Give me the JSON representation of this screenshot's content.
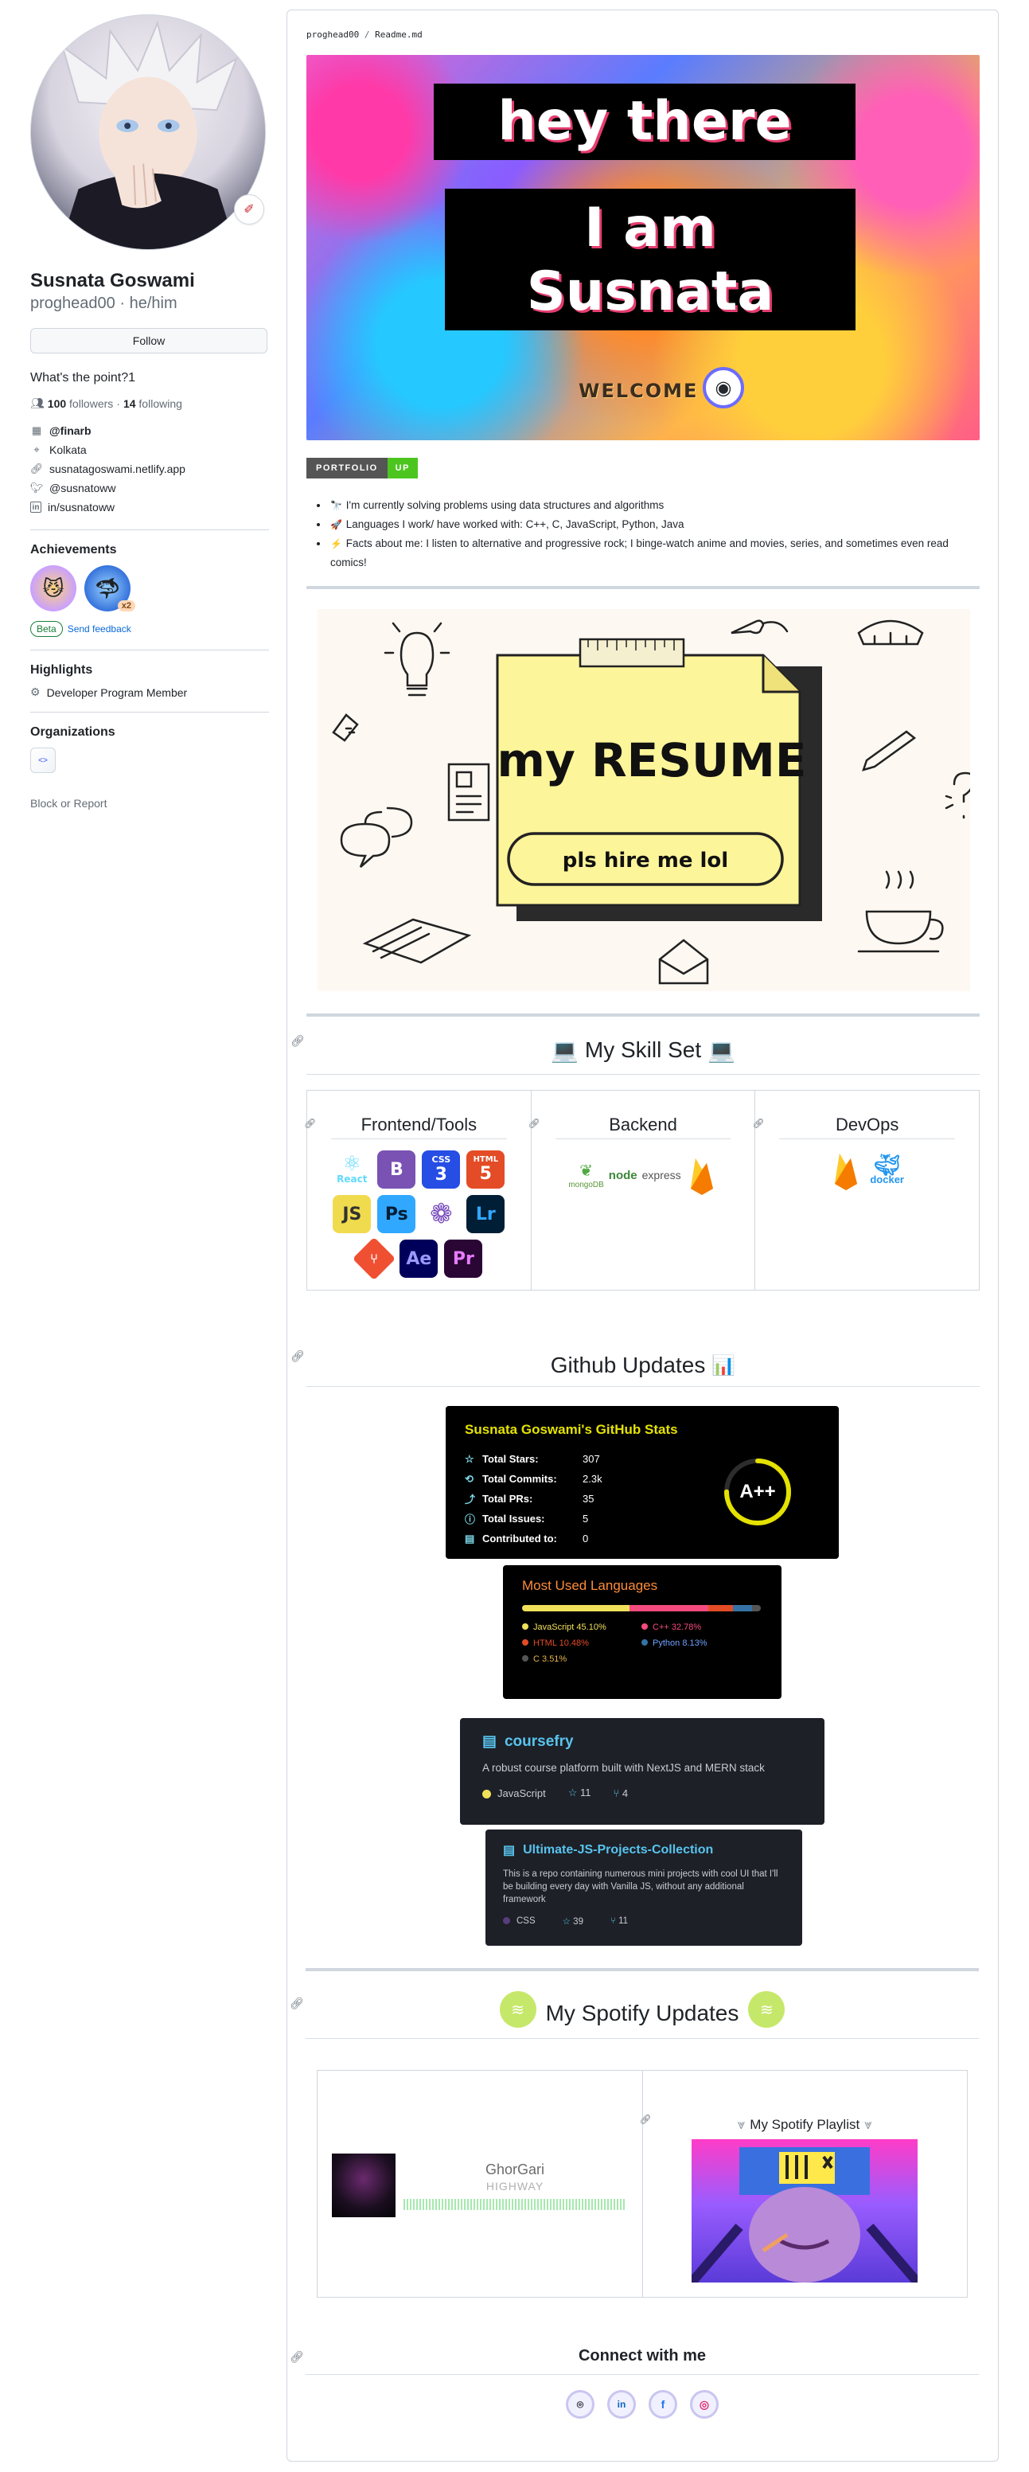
{
  "profile": {
    "name": "Susnata Goswami",
    "login": "proghead00",
    "pronouns": "he/him",
    "follow_label": "Follow",
    "bio": "What's the point?1",
    "followers_count": "100",
    "followers_label": "followers",
    "following_count": "14",
    "following_label": "following",
    "company": "@finarb",
    "location": "Kolkata",
    "website": "susnatagoswami.netlify.app",
    "twitter": "@susnatoww",
    "linkedin": "in/susnatoww",
    "separator_dot": "·"
  },
  "achievements": {
    "title": "Achievements",
    "badge_multiplier": "x2",
    "beta_label": "Beta",
    "feedback_label": "Send feedback"
  },
  "highlights": {
    "title": "Highlights",
    "item": "Developer Program Member"
  },
  "organizations": {
    "title": "Organizations",
    "block_label": "Block or Report"
  },
  "readme": {
    "path_user": "proghead00",
    "path_sep": "/",
    "path_file": "Readme.md",
    "banner_line1": "hey there",
    "banner_line2": "I am",
    "banner_line3": "Susnata",
    "banner_welcome": "WELCOME",
    "portfolio_left": "PORTFOLIO",
    "portfolio_right": "UP",
    "bullets": [
      {
        "emoji": "🔭",
        "text": "I'm currently solving problems using data structures and algorithms"
      },
      {
        "emoji": "🚀",
        "text": "Languages I work/ have worked with: C++, C, JavaScript, Python, Java"
      },
      {
        "emoji": "⚡",
        "text": "Facts about me: I listen to alternative and progressive rock; I binge-watch anime and movies, series, and sometimes even read comics!"
      }
    ],
    "resume_title": "my RESUME",
    "resume_sub": "pls hire me lol"
  },
  "skills": {
    "heading": "My Skill Set",
    "heading_icon": "💻",
    "columns": [
      {
        "title": "Frontend/Tools"
      },
      {
        "title": "Backend"
      },
      {
        "title": "DevOps"
      }
    ],
    "frontend_icons": [
      "React",
      "B",
      "CSS",
      "HTML",
      "JS",
      "Ps",
      "Redux",
      "Lr",
      "Git",
      "Ae",
      "Pr"
    ],
    "backend_icons": [
      "mongoDB",
      "node",
      "express",
      "Firebase"
    ],
    "devops_icons": [
      "Firebase",
      "docker"
    ]
  },
  "github": {
    "heading": "Github Updates",
    "heading_icon": "📊",
    "stats_title": "Susnata Goswami's GitHub Stats",
    "stats": [
      {
        "icon": "☆",
        "label": "Total Stars:",
        "value": "307"
      },
      {
        "icon": "⟲",
        "label": "Total Commits:",
        "value": "2.3k"
      },
      {
        "icon": "⤴",
        "label": "Total PRs:",
        "value": "35"
      },
      {
        "icon": "ⓘ",
        "label": "Total Issues:",
        "value": "5"
      },
      {
        "icon": "▤",
        "label": "Contributed to:",
        "value": "0"
      }
    ],
    "grade": "A++",
    "grade_progress": 0.75,
    "langs_title": "Most Used Languages",
    "langs": [
      {
        "name": "JavaScript",
        "percent": "45.10%",
        "value": 45.1,
        "color": "#f1e05a"
      },
      {
        "name": "C++",
        "percent": "32.78%",
        "value": 32.78,
        "color": "#f34b7d"
      },
      {
        "name": "HTML",
        "percent": "10.48%",
        "value": 10.48,
        "color": "#e34c26"
      },
      {
        "name": "Python",
        "percent": "8.13%",
        "value": 8.13,
        "color": "#3572A5"
      },
      {
        "name": "C",
        "percent": "3.51%",
        "value": 3.51,
        "color": "#555555"
      }
    ],
    "pins": [
      {
        "name": "coursefry",
        "desc": "A robust course platform built with NextJS and MERN stack",
        "lang": "JavaScript",
        "lang_color": "#f1e05a",
        "stars": "11",
        "forks": "4"
      },
      {
        "name": "Ultimate-JS-Projects-Collection",
        "desc": "This is a repo containing numerous mini projects with cool UI that I'll be building every day with Vanilla JS, without any additional framework",
        "lang": "CSS",
        "lang_color": "#563d7c",
        "stars": "39",
        "forks": "11"
      }
    ]
  },
  "spotify": {
    "heading": "My Spotify Updates",
    "track_title": "GhorGari",
    "track_artist": "HIGHWAY",
    "playlist_title": "My Spotify Playlist"
  },
  "connect": {
    "heading": "Connect with me",
    "links": [
      {
        "name": "github",
        "glyph": "⌾"
      },
      {
        "name": "linkedin",
        "glyph": "in"
      },
      {
        "name": "facebook",
        "glyph": "f"
      },
      {
        "name": "instagram",
        "glyph": "◎"
      }
    ]
  },
  "colors": {
    "accent": "#0969da",
    "success": "#1a7f37",
    "stats_title": "#e4e200",
    "langs_title": "#ff8c3a",
    "pin_link": "#58c4ef"
  }
}
